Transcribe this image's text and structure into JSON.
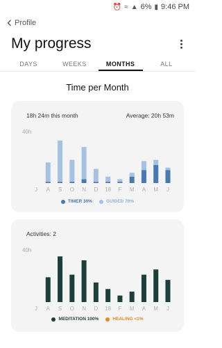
{
  "status_bar": {
    "battery": "6%",
    "time": "9:46 PM"
  },
  "header": {
    "back_label": "Profile",
    "title": "My progress"
  },
  "tabs": [
    "DAYS",
    "WEEKS",
    "MONTHS",
    "ALL"
  ],
  "active_tab": "MONTHS",
  "section_title": "Time per Month",
  "colors": {
    "timer": "#4a79b2",
    "guided": "#a6c1e2",
    "meditation": "#1c3f38",
    "healing": "#e58a1f"
  },
  "time_card": {
    "total_label": "18h 24m this month",
    "average_label": "Average: 20h 53m",
    "ytick": "40h",
    "legend": [
      {
        "label": "TIMER 30%"
      },
      {
        "label": "GUIDED 70%"
      }
    ]
  },
  "activity_card": {
    "activities_label": "Activities: 2",
    "ytick": "40h",
    "legend": [
      {
        "label": "MEDITATION 100%"
      },
      {
        "label": "HEALING <1%"
      }
    ]
  },
  "chart_data": [
    {
      "type": "bar",
      "stacked": true,
      "categories": [
        "J",
        "A",
        "S",
        "O",
        "N",
        "D",
        "18",
        "F",
        "M",
        "A",
        "M",
        "J"
      ],
      "series": [
        {
          "name": "TIMER",
          "values": [
            0,
            1,
            1,
            1,
            3,
            1,
            1,
            1,
            5,
            10,
            14,
            10
          ]
        },
        {
          "name": "GUIDED",
          "values": [
            0,
            15,
            32,
            17,
            25,
            10,
            4,
            2,
            3,
            7,
            4,
            2
          ]
        }
      ],
      "ytick_label": "40h",
      "ylim": [
        0,
        40
      ]
    },
    {
      "type": "bar",
      "categories": [
        "J",
        "A",
        "S",
        "O",
        "N",
        "D",
        "18",
        "F",
        "M",
        "A",
        "M",
        "J"
      ],
      "series": [
        {
          "name": "MEDITATION",
          "values": [
            0,
            19,
            35,
            21,
            32,
            15,
            10,
            5,
            8,
            21,
            25,
            17
          ]
        }
      ],
      "ytick_label": "40h",
      "ylim": [
        0,
        40
      ]
    }
  ]
}
